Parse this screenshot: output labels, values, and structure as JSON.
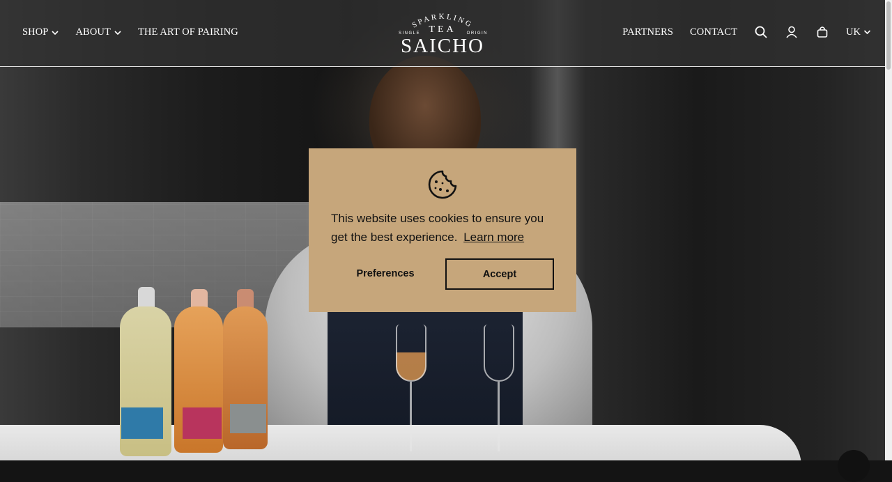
{
  "header": {
    "nav_left": [
      {
        "label": "SHOP",
        "has_dropdown": true
      },
      {
        "label": "ABOUT",
        "has_dropdown": true
      },
      {
        "label": "THE ART OF PAIRING",
        "has_dropdown": false
      }
    ],
    "nav_right": [
      {
        "label": "PARTNERS"
      },
      {
        "label": "CONTACT"
      }
    ],
    "icons": [
      "search-icon",
      "account-icon",
      "cart-icon"
    ],
    "locale": "UK",
    "logo": {
      "arc_text": "SPARKLING",
      "tea": "TEA",
      "left_tag": "SINGLE",
      "right_tag": "ORIGIN",
      "name": "SAICHO"
    }
  },
  "cookie_banner": {
    "message": "This website uses cookies to ensure you get the best experience.",
    "learn_more": "Learn more",
    "preferences_label": "Preferences",
    "accept_label": "Accept",
    "icon": "cookie-icon",
    "background_color": "#c6a67b"
  },
  "colors": {
    "header_text": "#ffffff",
    "button_border": "#111111"
  }
}
